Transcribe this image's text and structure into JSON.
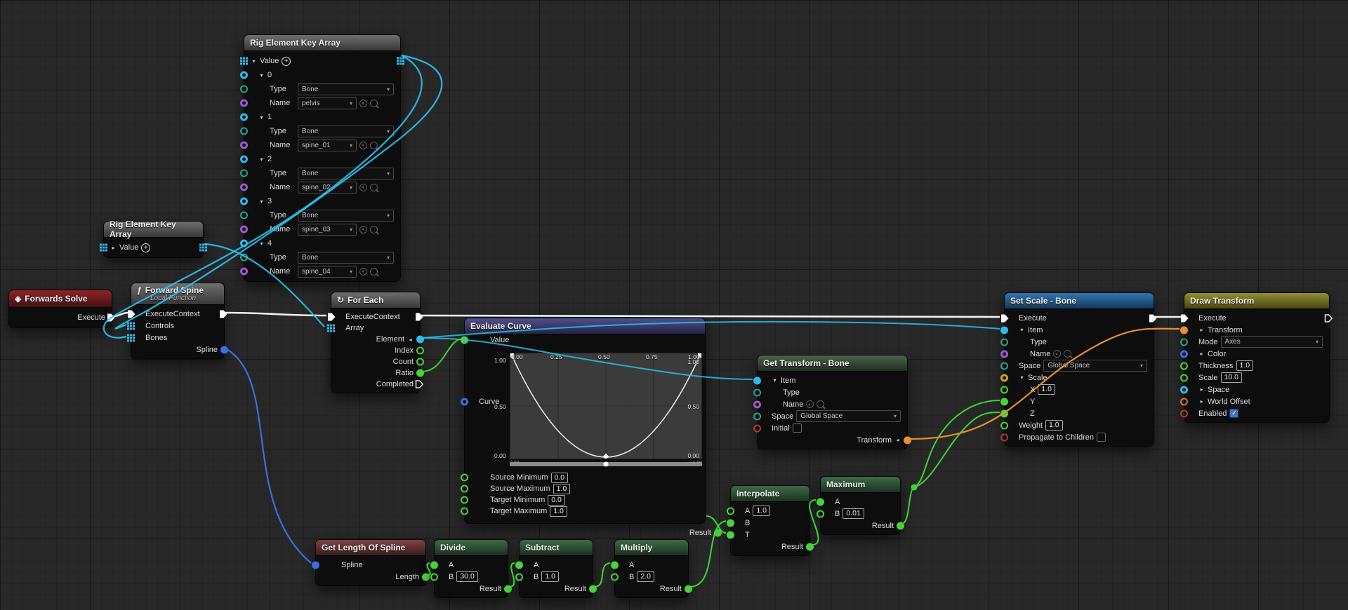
{
  "icons": {
    "expanded": "▾",
    "collapsed": "▸",
    "collapseLeft": "◂",
    "fn": "ƒ",
    "loop": "↻",
    "diamond": "◈",
    "chevron": "▾",
    "check": "✓"
  },
  "colors": {
    "execWire": "#f2f2f2",
    "arrayWire": "#29c2ee",
    "dataGreen": "#3fd435",
    "splineBlue": "#3a6fe0",
    "transformOrange": "#e8912d",
    "pinCyan": "#2fb9ea",
    "pinPurple": "#9b59d0",
    "pinTeal": "#2aa389",
    "pinRed": "#b03a2e",
    "pinYellow": "#c9a227"
  },
  "nodes": {
    "rigArrayBig": {
      "title": "Rig Element Key Array",
      "valueLabel": "Value",
      "typeLabel": "Type",
      "nameLabel": "Name",
      "entries": [
        {
          "index": "0",
          "type": "Bone",
          "name": "pelvis"
        },
        {
          "index": "1",
          "type": "Bone",
          "name": "spine_01"
        },
        {
          "index": "2",
          "type": "Bone",
          "name": "spine_02"
        },
        {
          "index": "3",
          "type": "Bone",
          "name": "spine_03"
        },
        {
          "index": "4",
          "type": "Bone",
          "name": "spine_04"
        }
      ]
    },
    "rigArraySmall": {
      "title": "Rig Element Key Array",
      "valueLabel": "Value"
    },
    "forwardsSolve": {
      "title": "Forwards Solve",
      "executeLabel": "Execute"
    },
    "forwardSpine": {
      "title": "Forward Spine",
      "subtitle": "Local Function",
      "execLabel": "ExecuteContext",
      "controlsLabel": "Controls",
      "bonesLabel": "Bones",
      "splineLabel": "Spline"
    },
    "forEach": {
      "title": "For Each",
      "execLabel": "ExecuteContext",
      "arrayLabel": "Array",
      "elementLabel": "Element",
      "indexLabel": "Index",
      "countLabel": "Count",
      "ratioLabel": "Ratio",
      "completedLabel": "Completed"
    },
    "evaluateCurve": {
      "title": "Evaluate Curve",
      "valueLabel": "Value",
      "curveLabel": "Curve",
      "resultLabel": "Result",
      "axisTop": [
        "0.00",
        "0.25",
        "0.50",
        "0.75",
        "1.00"
      ],
      "axisLeft": [
        "1.00",
        "0.50",
        "0.00"
      ],
      "axisRight": [
        "1.00",
        "0.50",
        "0.00"
      ],
      "sliderMin": "0.00",
      "sliderMax": "1.00",
      "fields": [
        {
          "label": "Source Minimum",
          "value": "0.0"
        },
        {
          "label": "Source Maximum",
          "value": "1.0"
        },
        {
          "label": "Target Minimum",
          "value": "0.0"
        },
        {
          "label": "Target Maximum",
          "value": "1.0"
        }
      ]
    },
    "getTransform": {
      "title": "Get Transform - Bone",
      "itemLabel": "Item",
      "typeLabel": "Type",
      "nameLabel": "Name",
      "spaceLabel": "Space",
      "spaceValue": "Global Space",
      "initialLabel": "Initial",
      "transformLabel": "Transform"
    },
    "interpolate": {
      "title": "Interpolate",
      "aLabel": "A",
      "aValue": "1.0",
      "bLabel": "B",
      "tLabel": "T",
      "resultLabel": "Result"
    },
    "maximum": {
      "title": "Maximum",
      "aLabel": "A",
      "bLabel": "B",
      "bValue": "0.01",
      "resultLabel": "Result"
    },
    "setScale": {
      "title": "Set Scale - Bone",
      "executeLabel": "Execute",
      "itemLabel": "Item",
      "typeLabel": "Type",
      "nameLabel": "Name",
      "spaceLabel": "Space",
      "spaceValue": "Global Space",
      "scaleLabel": "Scale",
      "xLabel": "X",
      "xValue": "1.0",
      "yLabel": "Y",
      "zLabel": "Z",
      "weightLabel": "Weight",
      "weightValue": "1.0",
      "propagateLabel": "Propagate to Children"
    },
    "drawTransform": {
      "title": "Draw Transform",
      "executeLabel": "Execute",
      "transformLabel": "Transform",
      "modeLabel": "Mode",
      "modeValue": "Axes",
      "colorLabel": "Color",
      "thicknessLabel": "Thickness",
      "thicknessValue": "1.0",
      "scaleLabel": "Scale",
      "scaleValue": "10.0",
      "spaceLabel": "Space",
      "worldOffsetLabel": "World Offset",
      "enabledLabel": "Enabled"
    },
    "getLength": {
      "title": "Get Length Of Spline",
      "splineLabel": "Spline",
      "lengthLabel": "Length"
    },
    "divide": {
      "title": "Divide",
      "aLabel": "A",
      "bLabel": "B",
      "bValue": "30.0",
      "resultLabel": "Result"
    },
    "subtract": {
      "title": "Subtract",
      "aLabel": "A",
      "bLabel": "B",
      "bValue": "1.0",
      "resultLabel": "Result"
    },
    "multiply": {
      "title": "Multiply",
      "aLabel": "A",
      "bLabel": "B",
      "bValue": "2.0",
      "resultLabel": "Result"
    }
  }
}
